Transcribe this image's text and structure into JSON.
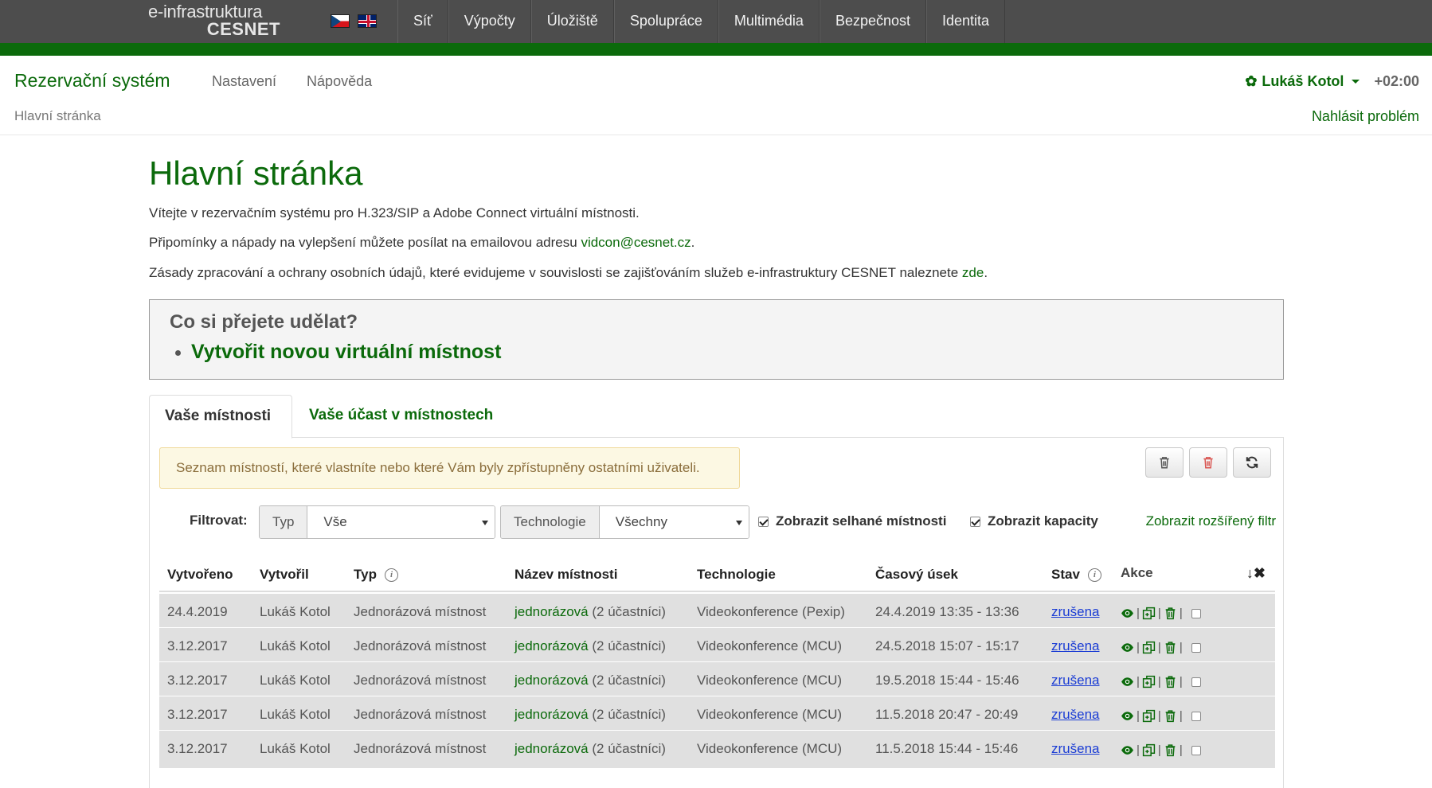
{
  "brand": {
    "line1": "e-infrastruktura",
    "line2": "CESNET"
  },
  "topnav": [
    "Síť",
    "Výpočty",
    "Úložiště",
    "Spolupráce",
    "Multimédia",
    "Bezpečnost",
    "Identita"
  ],
  "header": {
    "app_title": "Rezervační systém",
    "nav": [
      "Nastavení",
      "Nápověda"
    ],
    "breadcrumb": "Hlavní stránka",
    "user": "Lukáš Kotol",
    "timezone": "+02:00",
    "report": "Nahlásit problém"
  },
  "page": {
    "title": "Hlavní stránka",
    "p1": "Vítejte v rezervačním systému pro H.323/SIP a Adobe Connect virtuální místnosti.",
    "p2_text": "Připomínky a nápady na vylepšení můžete posílat na emailovou adresu ",
    "p2_link": "vidcon@cesnet.cz",
    "p2_end": ".",
    "p3_text": "Zásady zpracování a ochrany osobních údajů, které evidujeme v souvislosti se zajišťováním služeb e-infrastruktury CESNET naleznete ",
    "p3_link": "zde",
    "p3_end": ".",
    "todo_question": "Co si přejete udělat?",
    "todo_action": "Vytvořit novou virtuální místnost"
  },
  "tabs": [
    "Vaše místnosti",
    "Vaše účast v místnostech"
  ],
  "alert": "Seznam místností, které vlastníte nebo které Vám byly zpřístupněny ostatními uživateli.",
  "filters": {
    "label": "Filtrovat:",
    "type_addon": "Typ",
    "type_value": "Vše",
    "tech_addon": "Technologie",
    "tech_value": "Všechny",
    "show_failed": "Zobrazit selhané místnosti",
    "show_capacities": "Zobrazit kapacity",
    "advanced": "Zobrazit rozšířený filtr"
  },
  "table": {
    "headers": [
      "Vytvořeno",
      "Vytvořil",
      "Typ",
      "Název místnosti",
      "Technologie",
      "Časový úsek",
      "Stav",
      "Akce"
    ],
    "sort_label": "↓✖",
    "rows": [
      {
        "created": "24.4.2019",
        "author": "Lukáš Kotol",
        "type": "Jednorázová místnost",
        "name": "jednorázová",
        "participants": "(2 účastníci)",
        "tech": "Videokonference (Pexip)",
        "slot": "24.4.2019 13:35 - 13:36",
        "state": "zrušena"
      },
      {
        "created": "3.12.2017",
        "author": "Lukáš Kotol",
        "type": "Jednorázová místnost",
        "name": "jednorázová",
        "participants": "(2 účastníci)",
        "tech": "Videokonference (MCU)",
        "slot": "24.5.2018 15:07 - 15:17",
        "state": "zrušena"
      },
      {
        "created": "3.12.2017",
        "author": "Lukáš Kotol",
        "type": "Jednorázová místnost",
        "name": "jednorázová",
        "participants": "(2 účastníci)",
        "tech": "Videokonference (MCU)",
        "slot": "19.5.2018 15:44 - 15:46",
        "state": "zrušena"
      },
      {
        "created": "3.12.2017",
        "author": "Lukáš Kotol",
        "type": "Jednorázová místnost",
        "name": "jednorázová",
        "participants": "(2 účastníci)",
        "tech": "Videokonference (MCU)",
        "slot": "11.5.2018 20:47 - 20:49",
        "state": "zrušena"
      },
      {
        "created": "3.12.2017",
        "author": "Lukáš Kotol",
        "type": "Jednorázová místnost",
        "name": "jednorázová",
        "participants": "(2 účastníci)",
        "tech": "Videokonference (MCU)",
        "slot": "11.5.2018 15:44 - 15:46",
        "state": "zrušena"
      }
    ]
  },
  "colors": {
    "brand_green": "#0b6a0b",
    "topbar": "#4d4d4d",
    "link_blue": "#1a3cd4",
    "alert_bg": "#fcf8e3"
  },
  "icons": [
    "flag-cz-icon",
    "flag-gb-icon",
    "gear-icon",
    "caret-down-icon",
    "trash-icon",
    "trash-red-icon",
    "refresh-icon",
    "info-icon",
    "eye-icon",
    "copy-icon",
    "checkbox-icon"
  ]
}
